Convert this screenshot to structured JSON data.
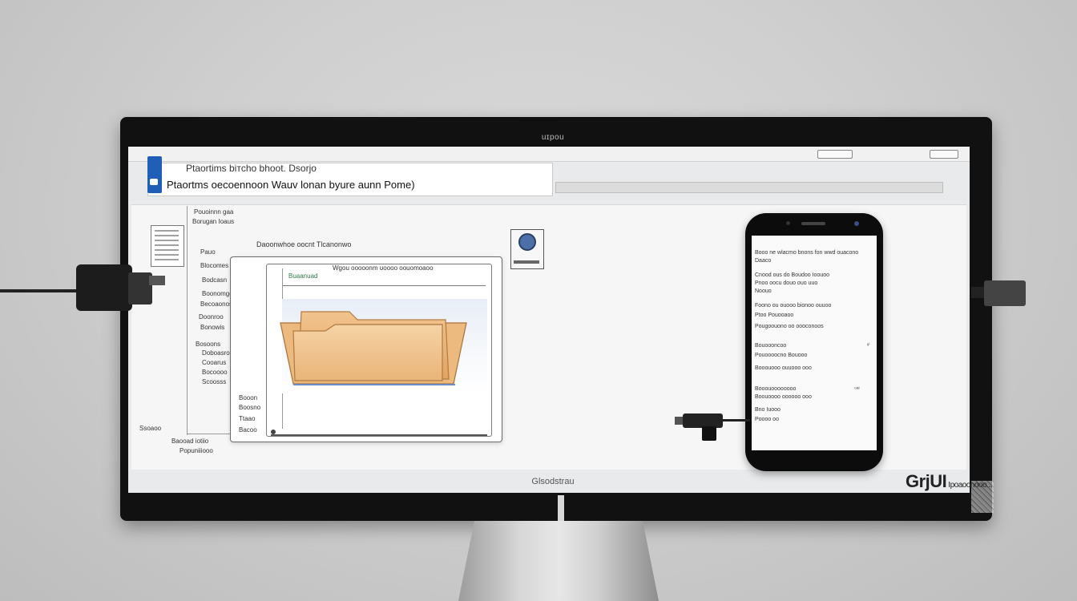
{
  "monitor": {
    "camera_label": "uɪpou",
    "brand_label": "Glsodstrau"
  },
  "window": {
    "title_line1": "Ptaortims biᴛcho bhoot. Dsorjo",
    "title_line2": "Ptaortms oecoennoon Wauv lonan byure aunn Pome)"
  },
  "sidebar": {
    "items": [
      "Pouoinnn gaa",
      "Borugan Ioaus",
      "Pauo",
      "Blocomes",
      "Bodcasn",
      "Boonomgc",
      "Becoaonos",
      "Doonroo",
      "Bonowis",
      "Bosoons",
      "Doboasros",
      "Cooarus",
      "Bocoooo",
      "Scoosss"
    ],
    "footer_a": "Ssoaoo",
    "footer_b": "Baooad iotiio",
    "footer_c": "Popuniiiooo"
  },
  "main_window": {
    "caption": "Daoonwhoe oocnt Tlcanonwo",
    "inner_caption": "Wgou ooooonm ʊoooo oouomoaoo",
    "inner_label": "Buaanuad",
    "side_items": [
      "Booon",
      "Boosno",
      "Ttaao",
      "Bacoo"
    ]
  },
  "app_icon": {
    "name": "app-icon"
  },
  "phone": {
    "lines": [
      "Booo ne wlacmo bnons fon wwd ouacono",
      "Daaco",
      "Cnood ous do Boudoo Ioouoo",
      "Pnoo oocu douo ouo uuo",
      "Noouo",
      "Foono ou ouooo bionoo ouuoo",
      "Ptoo Pouooaoo",
      "Pougoouono oo oooconoos",
      "Bouoooncoo",
      "Pouoooocno Bouooo",
      "Booouooo ouuooo ooo",
      "Booouoooooooo",
      "Boouoooo oooooo ooo",
      "Bno Iuooo",
      "Poooo oo"
    ],
    "side_marks": [
      "ᵛⁱ",
      "₀ₐᵢ"
    ]
  },
  "corner_brand": {
    "main": "GrjUI",
    "sub": "Ipoaoonooo..."
  }
}
